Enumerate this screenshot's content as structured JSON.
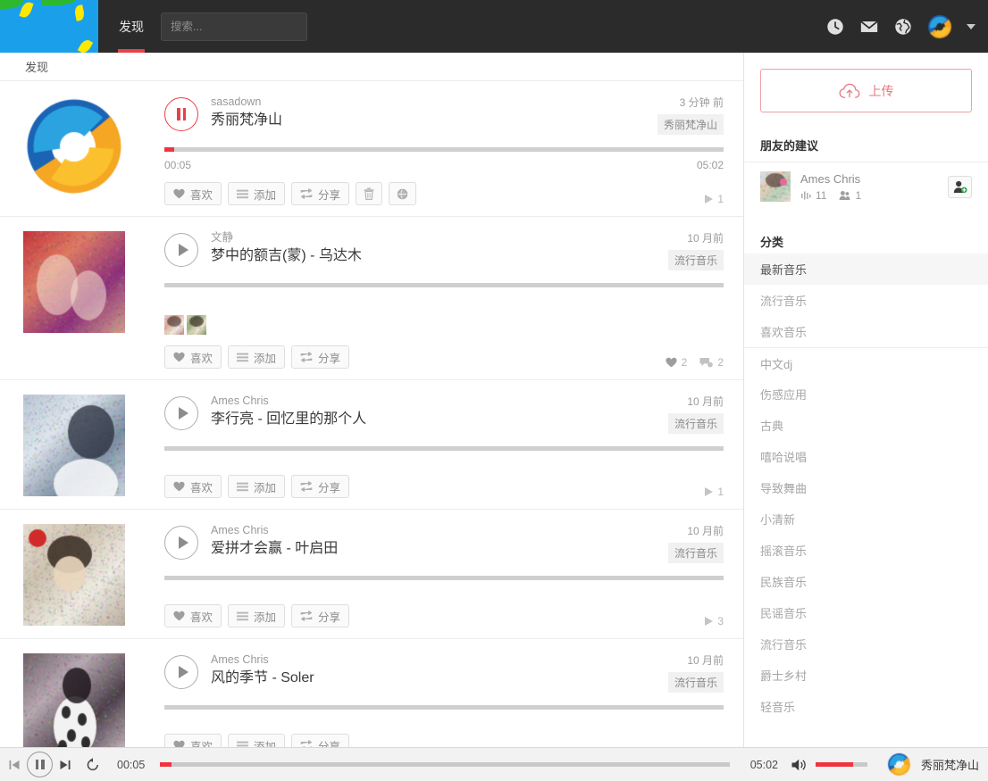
{
  "topbar": {
    "tab_label": "发现",
    "search_placeholder": "搜索...",
    "search_value": "",
    "icons": [
      "clock-icon",
      "mail-icon",
      "globe-icon"
    ]
  },
  "feed": {
    "heading": "发现",
    "tracks": [
      {
        "uploader": "sasadown",
        "title": "秀丽梵净山",
        "ago": "3 分钟 前",
        "genre": "秀丽梵净山",
        "time_current": "00:05",
        "time_total": "05:02",
        "progress_pct": 1.8,
        "playing": true,
        "actions": [
          "喜欢",
          "添加",
          "分享"
        ],
        "has_delete": true,
        "has_globe": true,
        "likers": [],
        "stats": [
          {
            "icon": "play-icon",
            "value": "1"
          }
        ],
        "cover": "logo"
      },
      {
        "uploader": "文静",
        "title": "梦中的额吉(蒙) - 乌达木",
        "ago": "10 月前",
        "genre": "流行音乐",
        "time_current": "",
        "time_total": "",
        "progress_pct": 0,
        "playing": false,
        "actions": [
          "喜欢",
          "添加",
          "分享"
        ],
        "has_delete": false,
        "has_globe": false,
        "likers": [
          "avatar-1",
          "avatar-2"
        ],
        "stats": [
          {
            "icon": "heart-icon",
            "value": "2"
          },
          {
            "icon": "comment-icon",
            "value": "2"
          }
        ],
        "cover": "photo-a"
      },
      {
        "uploader": "Ames Chris",
        "title": "李行亮 - 回忆里的那个人",
        "ago": "10 月前",
        "genre": "流行音乐",
        "time_current": "",
        "time_total": "",
        "progress_pct": 0,
        "playing": false,
        "actions": [
          "喜欢",
          "添加",
          "分享"
        ],
        "has_delete": false,
        "has_globe": false,
        "likers": [],
        "stats": [
          {
            "icon": "play-icon",
            "value": "1"
          }
        ],
        "cover": "photo-b"
      },
      {
        "uploader": "Ames Chris",
        "title": "爱拼才会赢 - 叶启田",
        "ago": "10 月前",
        "genre": "流行音乐",
        "time_current": "",
        "time_total": "",
        "progress_pct": 0,
        "playing": false,
        "actions": [
          "喜欢",
          "添加",
          "分享"
        ],
        "has_delete": false,
        "has_globe": false,
        "likers": [],
        "stats": [
          {
            "icon": "play-icon",
            "value": "3"
          }
        ],
        "cover": "photo-c"
      },
      {
        "uploader": "Ames Chris",
        "title": "风的季节 - Soler",
        "ago": "10 月前",
        "genre": "流行音乐",
        "time_current": "",
        "time_total": "",
        "progress_pct": 0,
        "playing": false,
        "actions": [
          "喜欢",
          "添加",
          "分享"
        ],
        "has_delete": false,
        "has_globe": false,
        "likers": [],
        "stats": [],
        "cover": "photo-d"
      }
    ]
  },
  "sidebar": {
    "upload_label": "上传",
    "friends_heading": "朋友的建议",
    "friend": {
      "name": "Ames Chris",
      "tracks_count": "11",
      "followers_count": "1"
    },
    "categories_heading": "分类",
    "categories": [
      {
        "label": "最新音乐",
        "active": true
      },
      {
        "label": "流行音乐",
        "active": false
      },
      {
        "label": "喜欢音乐",
        "active": false
      },
      {
        "label": "中文dj",
        "active": false,
        "separator": true
      },
      {
        "label": "伤感应用",
        "active": false
      },
      {
        "label": "古典",
        "active": false
      },
      {
        "label": "嘻哈说唱",
        "active": false
      },
      {
        "label": "导致舞曲",
        "active": false
      },
      {
        "label": "小清新",
        "active": false
      },
      {
        "label": "摇滚音乐",
        "active": false
      },
      {
        "label": "民族音乐",
        "active": false
      },
      {
        "label": "民谣音乐",
        "active": false
      },
      {
        "label": "流行音乐",
        "active": false
      },
      {
        "label": "爵士乡村",
        "active": false
      },
      {
        "label": "轻音乐",
        "active": false
      }
    ]
  },
  "player": {
    "time_current": "00:05",
    "time_total": "05:02",
    "progress_pct": 2,
    "volume_pct": 72,
    "track_title": "秀丽梵净山",
    "playing": true
  },
  "colors": {
    "accent_red": "#f0343f",
    "topbar_bg": "#2b2b2b",
    "upload_border": "#f1a0a4"
  }
}
